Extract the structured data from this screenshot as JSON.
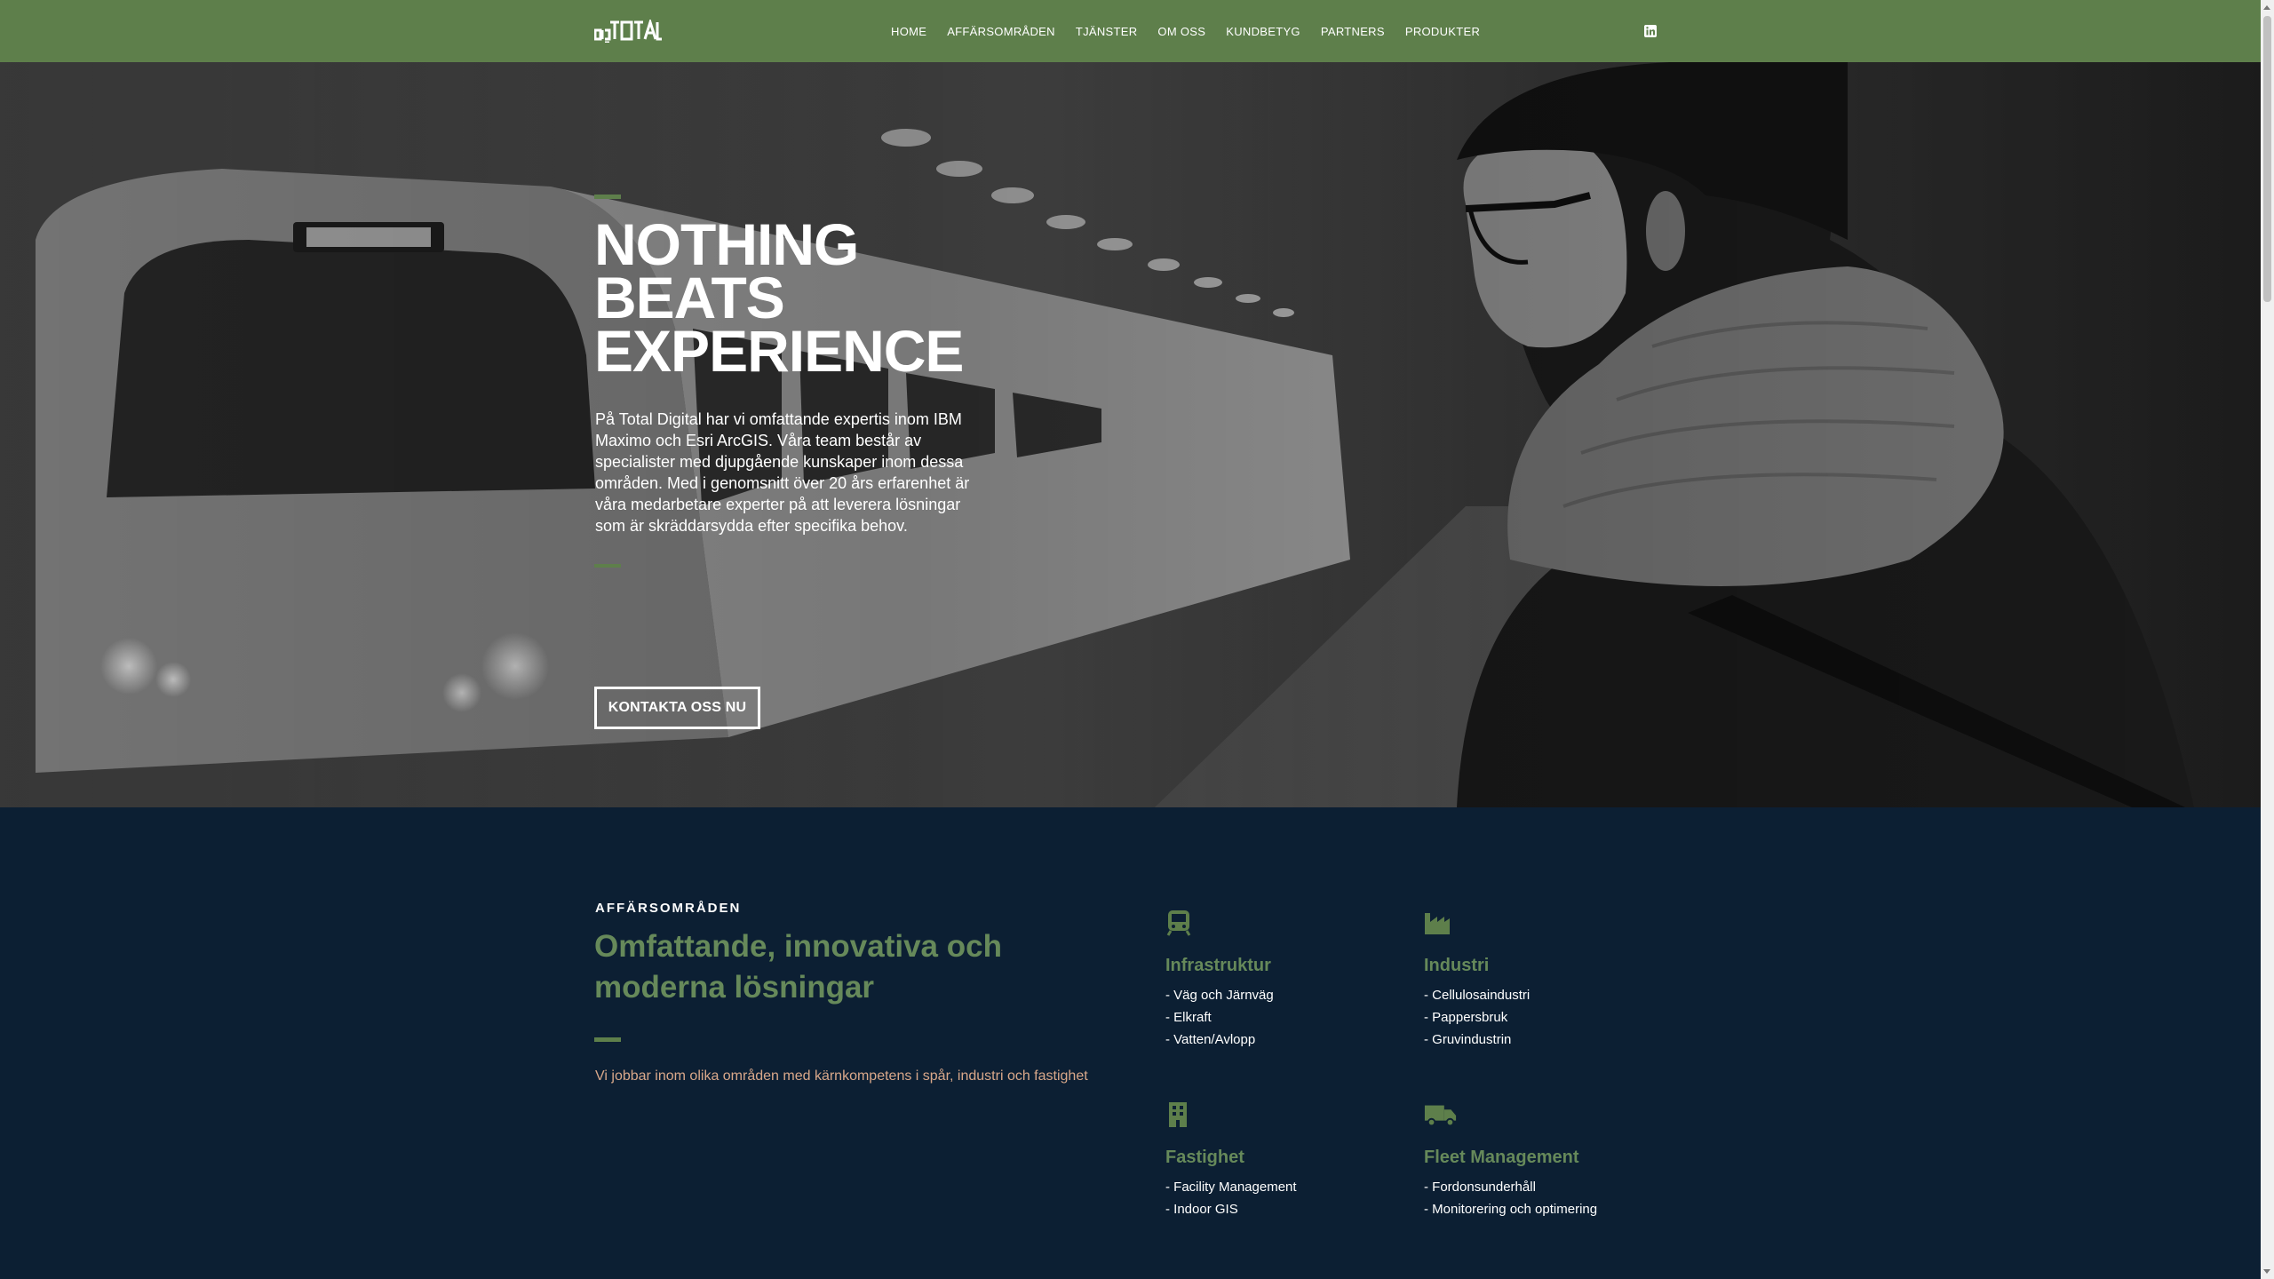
{
  "header": {
    "logo_alt": "Total Digital",
    "nav": [
      "HOME",
      "AFFÄRSOMRÅDEN",
      "TJÄNSTER",
      "OM OSS",
      "KUNDBETYG",
      "PARTNERS",
      "PRODUKTER"
    ],
    "social_icon": "linkedin-icon"
  },
  "hero": {
    "title_lines": [
      "NOTHING",
      "BEATS",
      "EXPERIENCE"
    ],
    "text": "På Total Digital har vi omfattande expertis inom IBM Maximo och Esri ArcGIS. Våra team består av specialister med djupgående kunskaper inom dessa områden. Med i genomsnitt över 20 års erfarenhet är våra medarbetare experter på att leverera lösningar som är skräddarsydda efter specifika behov.",
    "cta_label": "KONTAKTA OSS NU"
  },
  "section": {
    "eyebrow": "AFFÄRSOMRÅDEN",
    "title": "Omfattande, innovativa och moderna lösningar",
    "text": "Vi jobbar inom olika områden med kärnkompetens i spår, industri och fastighet"
  },
  "cards": [
    {
      "icon": "train-icon",
      "title": "Infrastruktur",
      "items": [
        "- Väg och Järnväg",
        "- Elkraft",
        "- Vatten/Avlopp"
      ]
    },
    {
      "icon": "factory-icon",
      "title": "Industri",
      "items": [
        "- Cellulosaindustri",
        "- Pappersbruk",
        "- Gruvindustrin"
      ]
    },
    {
      "icon": "building-icon",
      "title": "Fastighet",
      "items": [
        "- Facility Management",
        "- Indoor GIS"
      ]
    },
    {
      "icon": "truck-icon",
      "title": "Fleet Management",
      "items": [
        "- Fordonsunderhåll",
        "- Monitorering och optimering"
      ]
    }
  ],
  "colors": {
    "brand_green": "#5e7f4b",
    "heading_green": "#66895a",
    "navy": "#0c1f33",
    "muted_text": "#d9a88a"
  }
}
